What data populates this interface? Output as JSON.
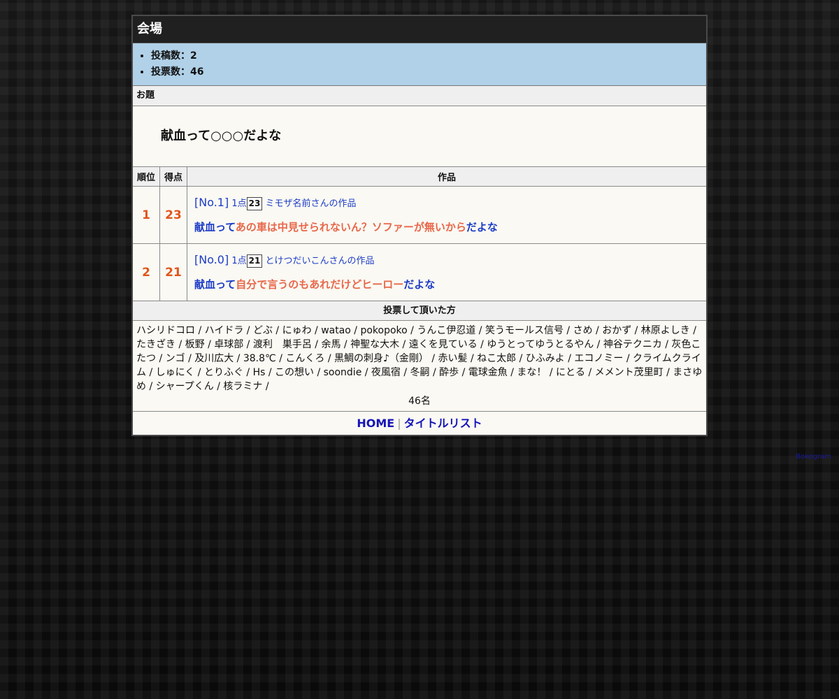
{
  "hall": {
    "title": "会場"
  },
  "stats": {
    "posts": "投稿数：2",
    "votes": "投票数：46"
  },
  "theme": {
    "header": "お題",
    "text": "献血って○○○だよな"
  },
  "table": {
    "headers": [
      "順位",
      "得点",
      "作品"
    ],
    "rows": [
      {
        "rank": "1",
        "score": "23",
        "no": "[No.1]",
        "points": "1点",
        "votes": "23",
        "author": "ミモザ名前さんの作品",
        "prefix": "献血って",
        "answer": "あの車は中見せられないん？ソファーが無いから",
        "suffix": "だよな"
      },
      {
        "rank": "2",
        "score": "21",
        "no": "[No.0]",
        "points": "1点",
        "votes": "21",
        "author": "とけつだいこんさんの作品",
        "prefix": "献血って",
        "answer": "自分で言うのもあれだけどヒーロー",
        "suffix": "だよな"
      }
    ]
  },
  "voters": {
    "header": "投票して頂いた方",
    "list": "ハシリドコロ / ハイドラ / どぶ / にゅわ / watao / pokopoko / うんこ伊忍道 / 笑うモールス信号 / さめ / おかず / 林原よしき / たきざき / 板野 / 卓球部 / 渡利　巣手呂 / 余馬 / 神聖な大木 / 遠くを見ている / ゆうとってゆうとるやん / 神谷テクニカ / 灰色こたつ / ンゴ / 及川広大 / 38.8℃ / こんくろ / 黒鯛の刺身♪（金剛） / 赤い髪 / ねこ太郎 / ひふみよ / エコノミー / クライムクライム / しゅにく / とりふぐ / Hs / この想い / soondie / 夜風宿 / 冬嗣 / 酔歩 / 電球金魚 / まな！ / にとる / メメント茂里町 / まさゆめ / シャープくん / 核ラミナ /",
    "count": "46名"
  },
  "footer": {
    "home": "HOME",
    "separator": "|",
    "titlelist": "タイトルリスト"
  },
  "credit": {
    "label": "Bokegram"
  },
  "colors": {
    "page_background": "#0b0b0b",
    "title_bar": "#202020",
    "stats_band": "#b0d1e8",
    "panel_background": "#faf9f3",
    "rank_score": "#e0561c",
    "link_blue": "#1c3cc8",
    "answer_orange": "#e8674a",
    "nav_link": "#1515b8"
  }
}
